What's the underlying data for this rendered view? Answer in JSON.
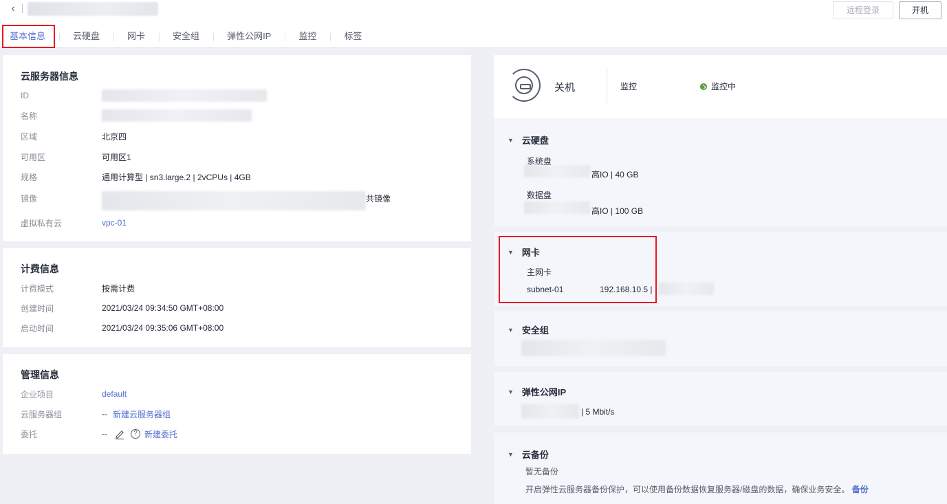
{
  "header": {
    "back_icon": "chevron-left-icon",
    "remote_login_label": "远程登录",
    "start_label": "开机"
  },
  "tabs": [
    {
      "label": "基本信息",
      "active": true
    },
    {
      "label": "云硬盘"
    },
    {
      "label": "网卡"
    },
    {
      "label": "安全组"
    },
    {
      "label": "弹性公网IP"
    },
    {
      "label": "监控"
    },
    {
      "label": "标签"
    }
  ],
  "server_info": {
    "title": "云服务器信息",
    "id_label": "ID",
    "name_label": "名称",
    "region_label": "区域",
    "region_value": "北京四",
    "az_label": "可用区",
    "az_value": "可用区1",
    "flavor_label": "规格",
    "flavor_value": "通用计算型 | sn3.large.2 | 2vCPUs | 4GB",
    "image_label": "镜像",
    "image_value_suffix": "共镜像",
    "vpc_label": "虚拟私有云",
    "vpc_value": "vpc-01"
  },
  "billing": {
    "title": "计费信息",
    "mode_label": "计费模式",
    "mode_value": "按需计费",
    "created_label": "创建时间",
    "created_value": "2021/03/24 09:34:50 GMT+08:00",
    "started_label": "启动时间",
    "started_value": "2021/03/24 09:35:06 GMT+08:00"
  },
  "management": {
    "title": "管理信息",
    "project_label": "企业项目",
    "project_value": "default",
    "group_label": "云服务器组",
    "group_value": "--",
    "group_link": "新建云服务器组",
    "agency_label": "委托",
    "agency_value": "--",
    "agency_link": "新建委托"
  },
  "status": {
    "power_state": "关机",
    "monitor_label": "监控",
    "monitor_state": "监控中"
  },
  "disks": {
    "title": "云硬盘",
    "system_label": "系统盘",
    "system_value": "高IO | 40 GB",
    "data_label": "数据盘",
    "data_value": "高IO | 100 GB"
  },
  "nic": {
    "title": "网卡",
    "primary_label": "主网卡",
    "subnet": "subnet-01",
    "ip": "192.168.10.5 |"
  },
  "security_group": {
    "title": "安全组"
  },
  "eip": {
    "title": "弹性公网IP",
    "bandwidth": "| 5 Mbit/s"
  },
  "backup": {
    "title": "云备份",
    "empty": "暂无备份",
    "desc": "开启弹性云服务器备份保护，可以使用备份数据恢复服务器/磁盘的数据，确保业务安全。",
    "link": "备份"
  },
  "colors": {
    "accent": "#526ecc",
    "highlight": "#e5191f",
    "ok": "#5e9e3b"
  }
}
